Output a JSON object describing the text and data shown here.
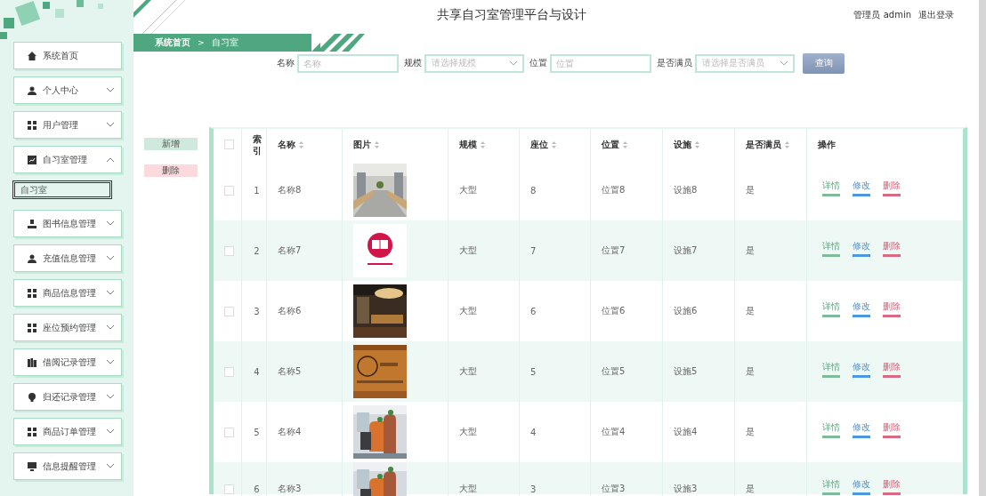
{
  "header": {
    "title": "共享自习室管理平台与设计",
    "user": "管理员 admin",
    "logout": "退出登录"
  },
  "sidebar": {
    "items": [
      {
        "label": "系统首页",
        "kind": "link"
      },
      {
        "label": "个人中心",
        "kind": "menu",
        "expanded": false
      },
      {
        "label": "用户管理",
        "kind": "menu",
        "expanded": false
      },
      {
        "label": "自习室管理",
        "kind": "menu",
        "expanded": true,
        "children": [
          {
            "label": "自习室",
            "selected": true
          }
        ]
      },
      {
        "label": "图书信息管理",
        "kind": "menu",
        "expanded": false
      },
      {
        "label": "充值信息管理",
        "kind": "menu",
        "expanded": false
      },
      {
        "label": "商品信息管理",
        "kind": "menu",
        "expanded": false
      },
      {
        "label": "座位预约管理",
        "kind": "menu",
        "expanded": false
      },
      {
        "label": "借阅记录管理",
        "kind": "menu",
        "expanded": false
      },
      {
        "label": "归还记录管理",
        "kind": "menu",
        "expanded": false
      },
      {
        "label": "商品订单管理",
        "kind": "menu",
        "expanded": false
      },
      {
        "label": "信息提醒管理",
        "kind": "menu",
        "expanded": false
      }
    ]
  },
  "breadcrumb": [
    "系统首页",
    "自习室"
  ],
  "breadcrumb_separator": ">",
  "search": {
    "fields": [
      {
        "label": "名称",
        "kind": "input",
        "placeholder": "名称"
      },
      {
        "label": "规模",
        "kind": "select",
        "placeholder": "请选择规模"
      },
      {
        "label": "位置",
        "kind": "input",
        "placeholder": "位置"
      },
      {
        "label": "是否满员",
        "kind": "select",
        "placeholder": "请选择是否满员"
      }
    ],
    "button": "查询"
  },
  "actions": [
    "新增",
    "删除"
  ],
  "table": {
    "select_all_checked": false,
    "columns": [
      {
        "label": "索引",
        "sortable": false
      },
      {
        "label": "名称",
        "sortable": true
      },
      {
        "label": "图片",
        "sortable": true
      },
      {
        "label": "规模",
        "sortable": true
      },
      {
        "label": "座位",
        "sortable": true
      },
      {
        "label": "位置",
        "sortable": true
      },
      {
        "label": "设施",
        "sortable": true
      },
      {
        "label": "是否满员",
        "sortable": true
      },
      {
        "label": "操作",
        "sortable": false
      }
    ],
    "rows": [
      {
        "checked": false,
        "cells": [
          "1",
          "名称8",
          {
            "kind": "picture"
          },
          "大型",
          "8",
          "位置8",
          "设施8",
          "是"
        ],
        "ops": [
          "详情",
          "修改",
          "删除"
        ]
      },
      {
        "checked": false,
        "cells": [
          "2",
          "名称7",
          {
            "kind": "picture"
          },
          "大型",
          "7",
          "位置7",
          "设施7",
          "是"
        ],
        "ops": [
          "详情",
          "修改",
          "删除"
        ]
      },
      {
        "checked": false,
        "cells": [
          "3",
          "名称6",
          {
            "kind": "picture"
          },
          "大型",
          "6",
          "位置6",
          "设施6",
          "是"
        ],
        "ops": [
          "详情",
          "修改",
          "删除"
        ]
      },
      {
        "checked": false,
        "cells": [
          "4",
          "名称5",
          {
            "kind": "picture"
          },
          "大型",
          "5",
          "位置5",
          "设施5",
          "是"
        ],
        "ops": [
          "详情",
          "修改",
          "删除"
        ]
      },
      {
        "checked": false,
        "cells": [
          "5",
          "名称4",
          {
            "kind": "picture"
          },
          "大型",
          "4",
          "位置4",
          "设施4",
          "是"
        ],
        "ops": [
          "详情",
          "修改",
          "删除"
        ]
      },
      {
        "checked": false,
        "cells": [
          "6",
          "名称3",
          {
            "kind": "picture"
          },
          "大型",
          "3",
          "位置3",
          "设施3",
          "是"
        ],
        "ops": [
          "详情",
          "修改",
          "删除"
        ]
      }
    ]
  }
}
